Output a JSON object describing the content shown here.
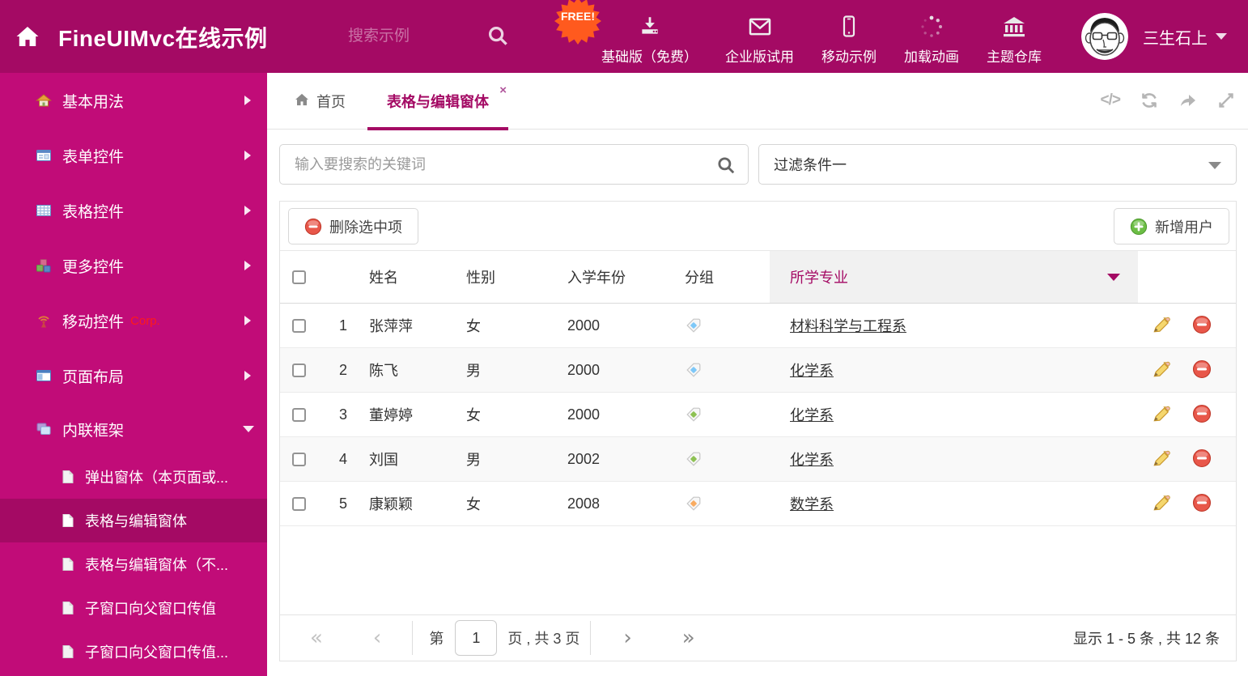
{
  "theme": {
    "header_bg": "#a40a64",
    "sidebar_bg": "#c10c78",
    "accent": "#a40a64",
    "free_badge_bg": "#ff5a1e",
    "tag_blue": "#7ec8f8",
    "tag_green": "#8dc153",
    "tag_orange": "#f9ab60"
  },
  "header": {
    "title": "FineUIMvc在线示例",
    "search_placeholder": "搜索示例",
    "free_badge": "FREE!",
    "nav": [
      {
        "label": "基础版（免费）",
        "icon": "download-icon"
      },
      {
        "label": "企业版试用",
        "icon": "mail-icon"
      },
      {
        "label": "移动示例",
        "icon": "mobile-icon"
      },
      {
        "label": "加载动画",
        "icon": "spinner-icon"
      },
      {
        "label": "主题仓库",
        "icon": "bank-icon"
      }
    ],
    "user": {
      "name": "三生石上"
    }
  },
  "sidebar": {
    "items": [
      {
        "label": "基本用法",
        "icon": "home-icon"
      },
      {
        "label": "表单控件",
        "icon": "form-icon"
      },
      {
        "label": "表格控件",
        "icon": "table-icon"
      },
      {
        "label": "更多控件",
        "icon": "cubes-icon"
      },
      {
        "label": "移动控件",
        "suffix": "Corp.",
        "icon": "antenna-icon"
      },
      {
        "label": "页面布局",
        "icon": "layout-icon"
      },
      {
        "label": "内联框架",
        "icon": "frames-icon",
        "expanded": true
      }
    ],
    "subitems": [
      {
        "label": "弹出窗体（本页面或..."
      },
      {
        "label": "表格与编辑窗体",
        "active": true
      },
      {
        "label": "表格与编辑窗体（不..."
      },
      {
        "label": "子窗口向父窗口传值"
      },
      {
        "label": "子窗口向父窗口传值..."
      }
    ]
  },
  "tabs": [
    {
      "label": "首页"
    },
    {
      "label": "表格与编辑窗体",
      "active": true,
      "closable": true
    }
  ],
  "icons": {
    "close": "×",
    "code": "</>",
    "first": "«",
    "prev": "‹",
    "next": "›",
    "last": "»"
  },
  "controls": {
    "search_placeholder": "输入要搜索的关键词",
    "filter_value": "过滤条件一"
  },
  "grid": {
    "buttons": {
      "delete": "删除选中项",
      "add": "新增用户"
    },
    "columns": {
      "name": "姓名",
      "gender": "性别",
      "year": "入学年份",
      "group": "分组",
      "major": "所学专业"
    },
    "rows": [
      {
        "index": "1",
        "name": "张萍萍",
        "gender": "女",
        "year": "2000",
        "tag": "blue",
        "major": "材料科学与工程系"
      },
      {
        "index": "2",
        "name": "陈飞",
        "gender": "男",
        "year": "2000",
        "tag": "blue",
        "major": "化学系"
      },
      {
        "index": "3",
        "name": "董婷婷",
        "gender": "女",
        "year": "2000",
        "tag": "green",
        "major": "化学系"
      },
      {
        "index": "4",
        "name": "刘国",
        "gender": "男",
        "year": "2002",
        "tag": "green",
        "major": "化学系"
      },
      {
        "index": "5",
        "name": "康颖颖",
        "gender": "女",
        "year": "2008",
        "tag": "orange",
        "major": "数学系"
      }
    ],
    "pagination": {
      "page_prefix": "第",
      "page_value": "1",
      "page_suffix": "页 , 共 3 页",
      "summary": "显示 1 - 5 条 , 共 12 条"
    }
  }
}
